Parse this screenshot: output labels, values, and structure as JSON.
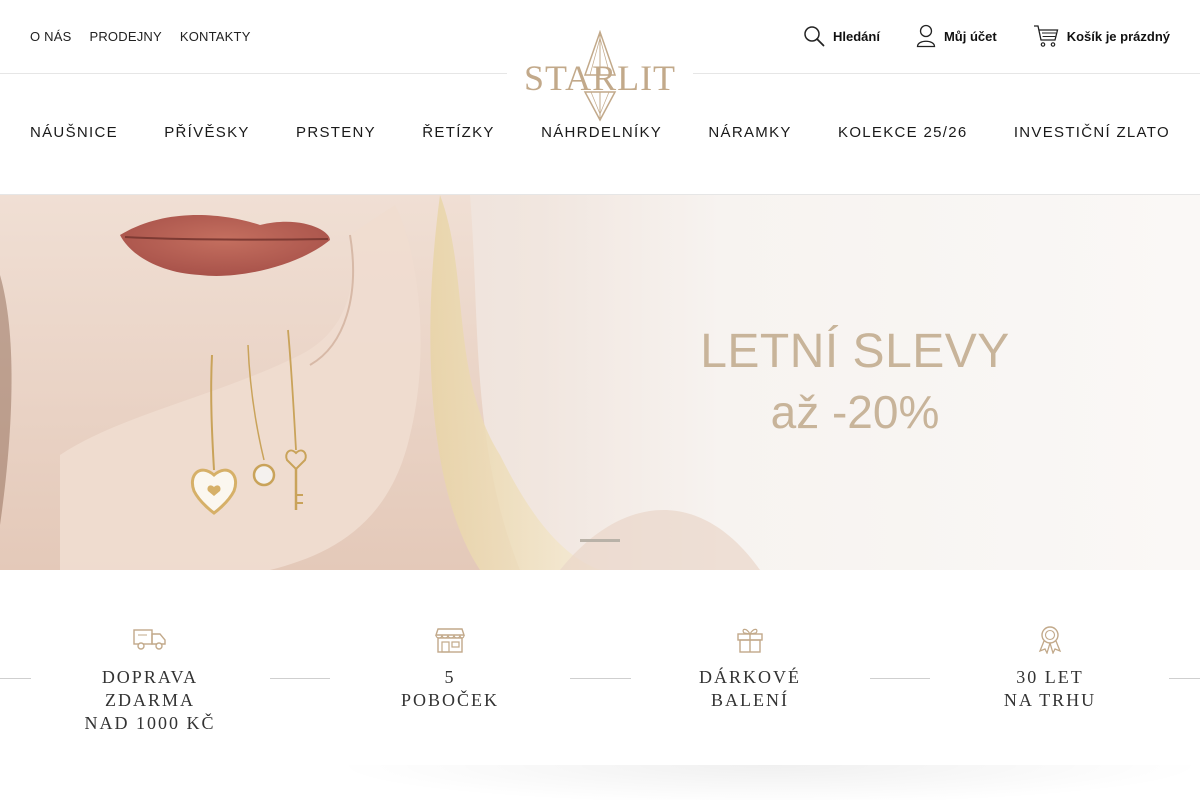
{
  "header": {
    "top_links": [
      "O NÁS",
      "PRODEJNY",
      "KONTAKTY"
    ],
    "search_label": "Hledání",
    "account_label": "Můj účet",
    "cart_label": "Košík je prázdný",
    "logo_text": "STARLIT",
    "brand_color": "#c2a98a"
  },
  "nav": {
    "items": [
      "NÁUŠNICE",
      "PŘÍVĚSKY",
      "PRSTENY",
      "ŘETÍZKY",
      "NÁHRDELNÍKY",
      "NÁRAMKY",
      "KOLEKCE 25/26",
      "INVESTIČNÍ ZLATO"
    ]
  },
  "hero": {
    "line1": "LETNÍ SLEVY",
    "line2": "až -20%",
    "text_color": "#c8b49a"
  },
  "features": [
    {
      "icon": "delivery-truck-icon",
      "lines": [
        "DOPRAVA",
        "ZDARMA",
        "NAD 1000 KČ"
      ]
    },
    {
      "icon": "store-icon",
      "lines": [
        "5",
        "POBOČEK"
      ]
    },
    {
      "icon": "gift-icon",
      "lines": [
        "DÁRKOVÉ",
        "BALENÍ"
      ]
    },
    {
      "icon": "award-icon",
      "lines": [
        "30 LET",
        "NA TRHU"
      ]
    }
  ]
}
